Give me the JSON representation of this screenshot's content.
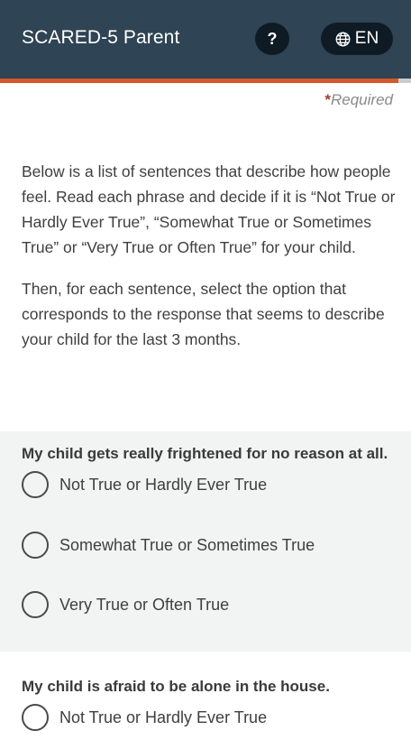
{
  "header": {
    "title": "SCARED-5 Parent",
    "help_label": "?",
    "language_label": "EN",
    "language_icon": "globe-icon",
    "bg_color": "#2f4454"
  },
  "progress": {
    "fraction": 0.97,
    "color": "#d5582a"
  },
  "required_star": "*",
  "required_label": "Required",
  "intro": {
    "p1": "Below is a list of sentences that describe how people feel. Read each phrase and decide if it is “Not True or Hardly Ever True”, “Somewhat True or Sometimes True” or “Very True or Often True” for your child.",
    "p2": "Then, for each sentence, select the option that corresponds to the response that seems to describe your child for the last 3 months."
  },
  "questions": [
    {
      "text": "My child gets really frightened for no reason at all.",
      "options": [
        "Not True or Hardly Ever True",
        "Somewhat True or Sometimes True",
        "Very True or Often True"
      ]
    },
    {
      "text": "My child is afraid to be alone in the house.",
      "options": [
        "Not True or Hardly Ever True"
      ]
    }
  ]
}
